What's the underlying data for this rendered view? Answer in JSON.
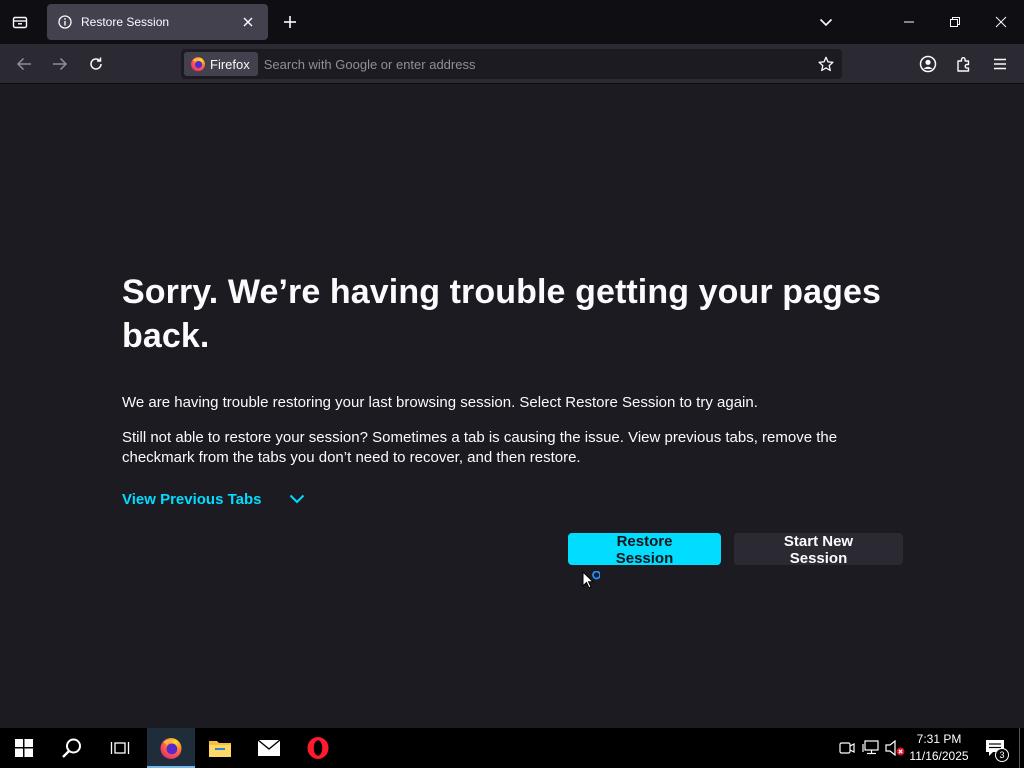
{
  "tabs": [
    {
      "title": "Restore Session",
      "icon": "info-icon",
      "active": true
    }
  ],
  "urlbar": {
    "identity_label": "Firefox",
    "placeholder": "Search with Google or enter address",
    "value": ""
  },
  "page": {
    "title": "Sorry. We’re having trouble getting your pages back.",
    "message1": "We are having trouble restoring your last browsing session. Select Restore Session to try again.",
    "message2": "Still not able to restore your session? Sometimes a tab is causing the issue. View previous tabs, remove the checkmark from the tabs you don’t need to recover, and then restore.",
    "view_tabs_label": "View Previous Tabs",
    "restore_button": "Restore Session",
    "new_session_button": "Start New Session"
  },
  "taskbar": {
    "apps": [
      "start-icon",
      "search-icon",
      "task-view-icon",
      "firefox-icon",
      "file-explorer-icon",
      "mail-icon",
      "opera-icon"
    ],
    "time": "7:31 PM",
    "date": "11/16/2025",
    "notification_count": "3"
  },
  "colors": {
    "accent": "#00ddff",
    "background": "#1c1b22",
    "toolbar": "#2b2a33",
    "tabstrip": "#0f0e13"
  }
}
